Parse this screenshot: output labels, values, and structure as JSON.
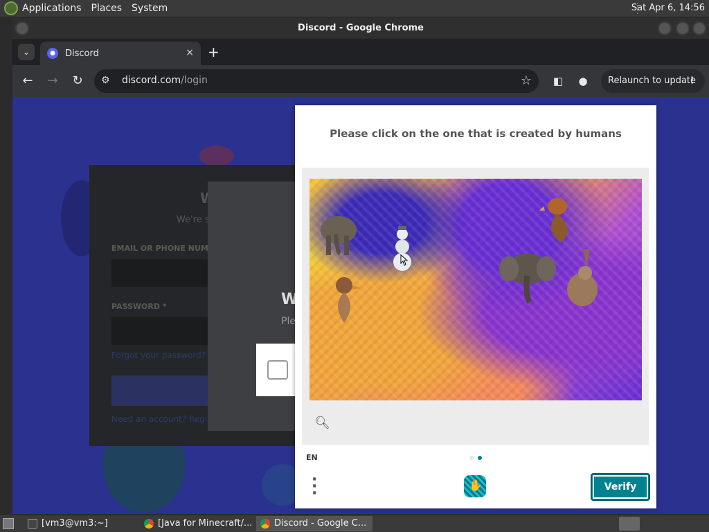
{
  "top_panel": {
    "menus": [
      "Applications",
      "Places",
      "System"
    ],
    "clock": "Sat Apr  6, 14:56"
  },
  "window": {
    "title": "Discord - Google Chrome",
    "tab": {
      "label": "Discord",
      "close": "×"
    },
    "new_tab": "+",
    "url_host": "discord.com",
    "url_path": "/login",
    "relaunch_label": "Relaunch to update"
  },
  "login_page": {
    "heading": "W",
    "subtitle": "We're s",
    "email_label": "EMAIL OR PHONE NUMB",
    "password_label": "PASSWORD *",
    "forgot_link": "Forgot your password?",
    "register_prompt": "Need an account? Regi",
    "inner_heading": "W",
    "inner_sub": "Ple"
  },
  "captcha": {
    "prompt": "Please click on the one that is created by humans",
    "language": "EN",
    "verify_label": "Verify",
    "accent_color": "#00838f",
    "animals": [
      "elephant",
      "snowman",
      "duck",
      "elephant",
      "duck",
      "rabbit"
    ]
  },
  "taskbar": {
    "items": [
      "[vm3@vm3:~]",
      "[Java for Minecraft/...",
      "Discord - Google C..."
    ]
  }
}
